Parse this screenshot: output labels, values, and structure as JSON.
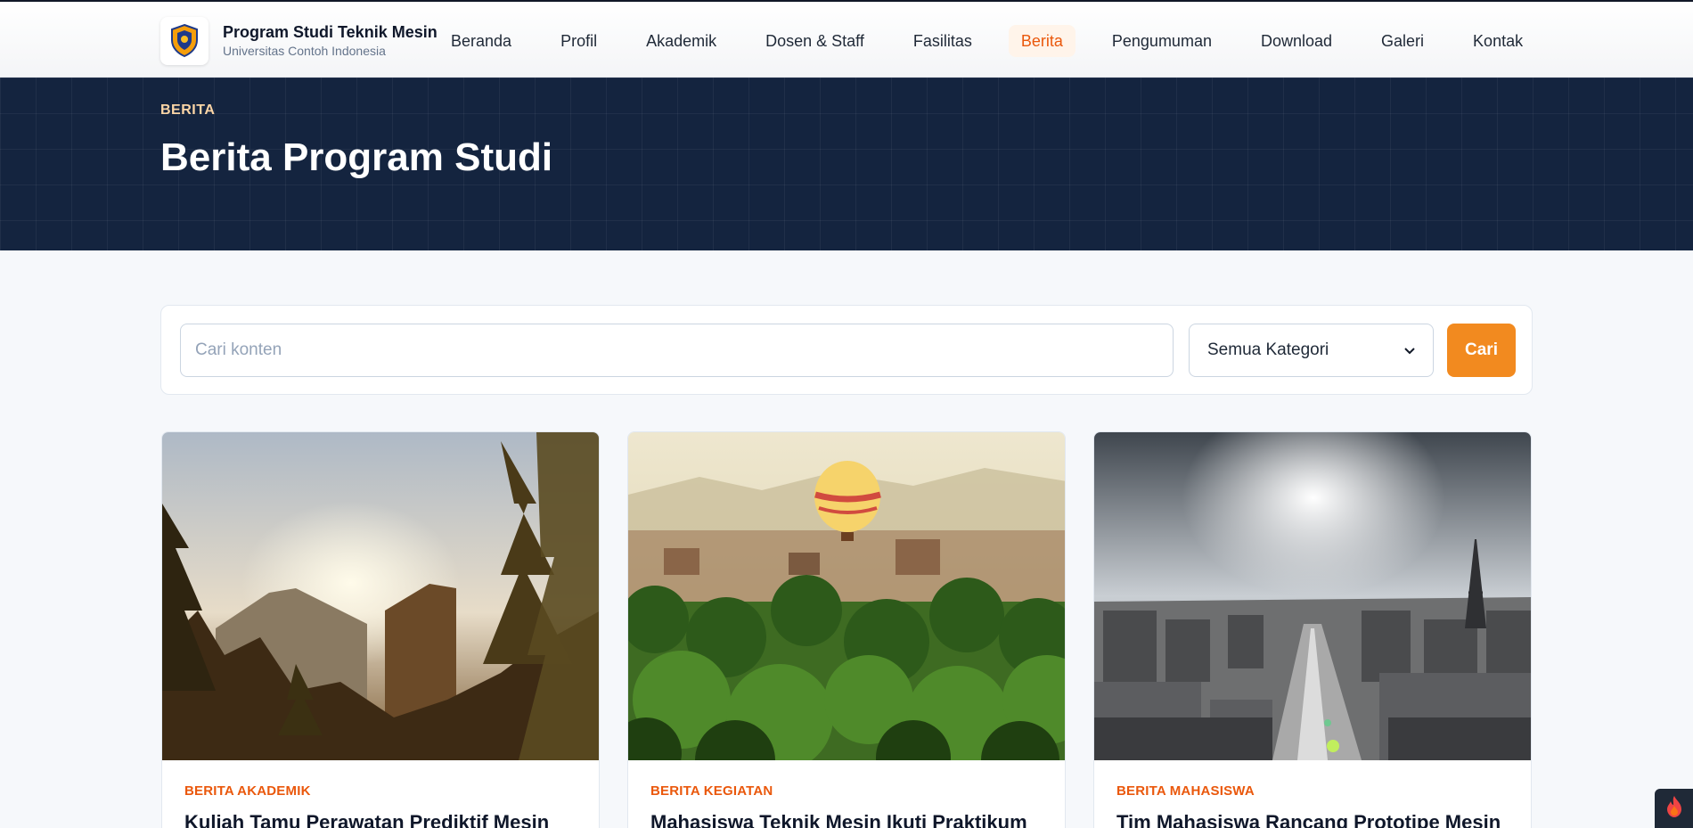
{
  "brand": {
    "title": "Program Studi Teknik Mesin",
    "subtitle": "Universitas Contoh Indonesia",
    "logo_icon": "university-crest-icon"
  },
  "nav": {
    "items": [
      {
        "label": "Beranda",
        "active": false
      },
      {
        "label": "Profil",
        "active": false
      },
      {
        "label": "Akademik",
        "active": false
      },
      {
        "label": "Dosen & Staff",
        "active": false
      },
      {
        "label": "Fasilitas",
        "active": false
      },
      {
        "label": "Berita",
        "active": true
      },
      {
        "label": "Pengumuman",
        "active": false
      },
      {
        "label": "Download",
        "active": false
      },
      {
        "label": "Galeri",
        "active": false
      },
      {
        "label": "Kontak",
        "active": false
      }
    ]
  },
  "hero": {
    "eyebrow": "BERITA",
    "title": "Berita Program Studi"
  },
  "search": {
    "placeholder": "Cari konten",
    "value": "",
    "category_selected": "Semua Kategori",
    "button_label": "Cari"
  },
  "cards": [
    {
      "category": "BERITA AKADEMIK",
      "title": "Kuliah Tamu Perawatan Prediktif Mesin",
      "image_icon": "sunset-forest-photo"
    },
    {
      "category": "BERITA KEGIATAN",
      "title": "Mahasiswa Teknik Mesin Ikuti Praktikum",
      "image_icon": "balloon-palms-photo"
    },
    {
      "category": "BERITA MAHASISWA",
      "title": "Tim Mahasiswa Rancang Prototipe Mesin",
      "image_icon": "city-skyline-photo"
    }
  ],
  "colors": {
    "accent": "#f28a1f",
    "accent_text": "#ea580c",
    "hero_bg": "#14243f"
  },
  "corner_badge": {
    "icon": "flame-icon"
  }
}
